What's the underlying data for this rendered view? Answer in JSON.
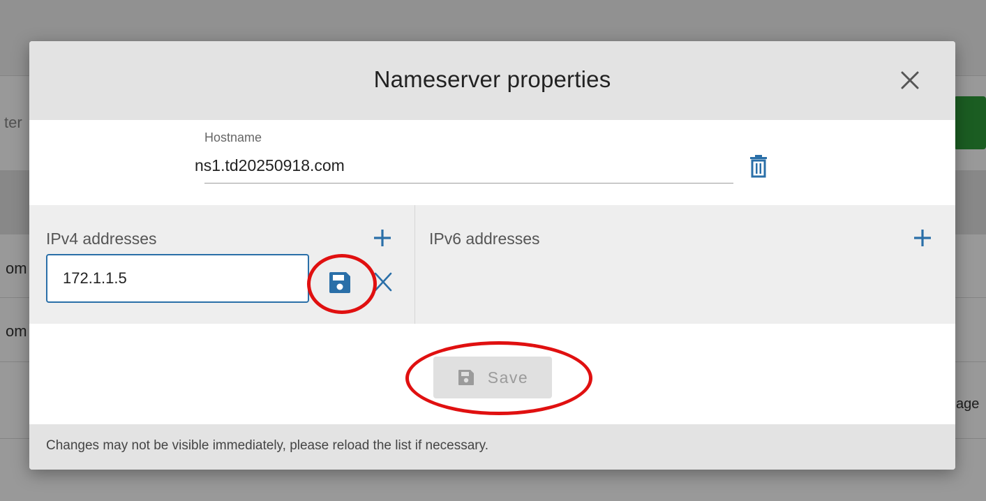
{
  "background": {
    "filter_fragment": "ter",
    "row_fragment_1": "om",
    "row_fragment_2": "om",
    "right_fragment": "age"
  },
  "modal": {
    "title": "Nameserver properties",
    "close_icon": "close-icon",
    "hostname": {
      "label": "Hostname",
      "value": "ns1.td20250918.com",
      "delete_icon": "trash-icon"
    },
    "ipv4": {
      "label": "IPv4 addresses",
      "add_icon": "plus-icon",
      "entries": [
        {
          "value": "172.1.1.5",
          "save_icon": "floppy-icon",
          "remove_icon": "close-icon"
        }
      ]
    },
    "ipv6": {
      "label": "IPv6 addresses",
      "add_icon": "plus-icon",
      "entries": []
    },
    "save_button": {
      "label": "Save",
      "icon": "floppy-icon",
      "disabled": true
    },
    "footer_note": "Changes may not be visible immediately, please reload the list if necessary."
  },
  "colors": {
    "accent": "#2a6fa8",
    "annotation": "#e01010",
    "disabled_text": "#9b9b9b"
  }
}
